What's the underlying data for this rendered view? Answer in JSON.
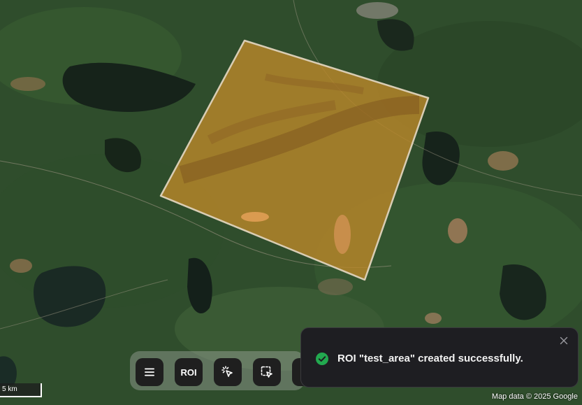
{
  "map": {
    "attribution": "Map data © 2025 Google",
    "scale_label": "5 km"
  },
  "toolbar": {
    "menu_icon": "menu-icon",
    "roi_label": "ROI",
    "pointer_icon": "click-pointer-icon",
    "select_icon": "box-select-icon"
  },
  "toast": {
    "message": "ROI \"test_area\" created successfully.",
    "status_icon": "check-circle-icon",
    "status_color": "#22a94f",
    "close_icon": "close-icon"
  },
  "roi": {
    "name": "test_area",
    "fill_color": "#b8862a",
    "border_color": "#d9cdb4"
  }
}
